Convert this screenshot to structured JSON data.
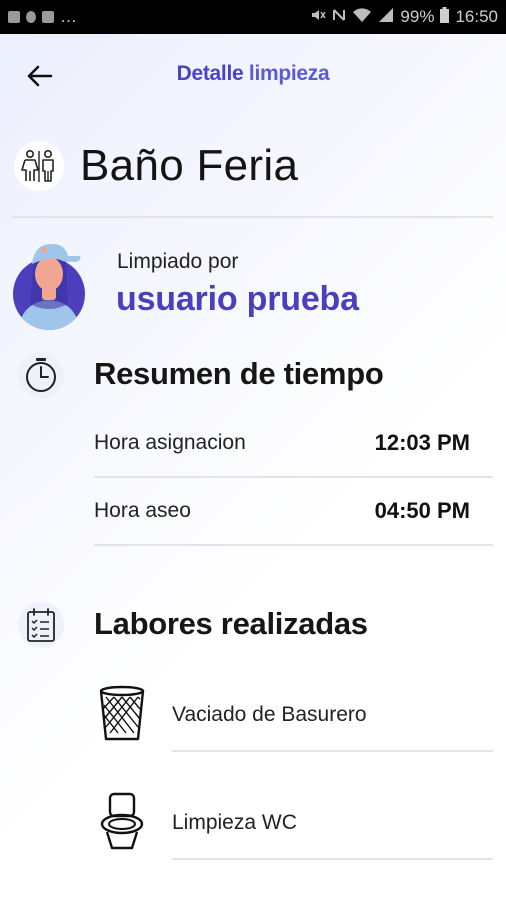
{
  "status_bar": {
    "left_text": "…",
    "battery": "99%",
    "time": "16:50"
  },
  "header": {
    "title_part1": "Detalle",
    "title_part2": "limpieza"
  },
  "location": {
    "name": "Baño Feria",
    "icon": "restroom-icon"
  },
  "cleaned_by": {
    "label": "Limpiado por",
    "user": "usuario prueba"
  },
  "time_summary": {
    "title": "Resumen de tiempo",
    "rows": [
      {
        "label": "Hora asignacion",
        "value": "12:03 PM"
      },
      {
        "label": "Hora aseo",
        "value": "04:50 PM"
      }
    ]
  },
  "tasks": {
    "title": "Labores realizadas",
    "items": [
      {
        "label": "Vaciado de Basurero",
        "icon": "trash-bin-icon"
      },
      {
        "label": "Limpieza WC",
        "icon": "toilet-icon"
      }
    ]
  },
  "colors": {
    "accent": "#4b3fbd",
    "title_accent": "#5b5bd9"
  }
}
